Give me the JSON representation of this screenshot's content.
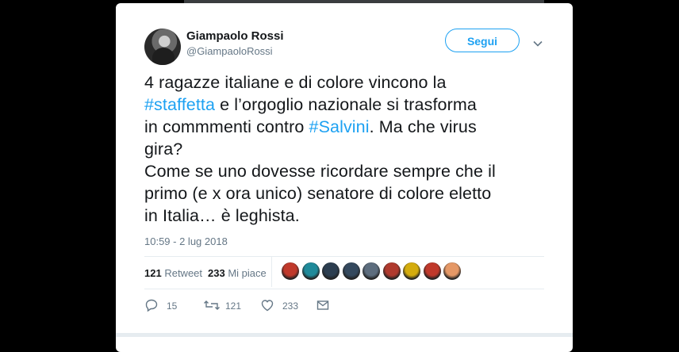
{
  "author": {
    "name": "Giampaolo Rossi",
    "handle": "@GiampaoloRossi"
  },
  "follow_button": {
    "label": "Segui"
  },
  "tweet": {
    "lines": [
      [
        {
          "t": "4 ragazze italiane e di colore vincono la",
          "h": false
        }
      ],
      [
        {
          "t": "#staffetta",
          "h": true
        },
        {
          "t": " e l’orgoglio nazionale si trasforma",
          "h": false
        }
      ],
      [
        {
          "t": "in commmenti contro ",
          "h": false
        },
        {
          "t": "#Salvini",
          "h": true
        },
        {
          "t": ". Ma che virus",
          "h": false
        }
      ],
      [
        {
          "t": "gira?",
          "h": false
        }
      ],
      [
        {
          "t": "Come se uno dovesse ricordare sempre che il",
          "h": false
        }
      ],
      [
        {
          "t": "primo (e x ora unico) senatore di colore eletto",
          "h": false
        }
      ],
      [
        {
          "t": "in Italia… è leghista.",
          "h": false
        }
      ]
    ],
    "timestamp": "10:59 - 2 lug 2018"
  },
  "stats": {
    "retweets_count": "121",
    "retweets_label": "Retweet",
    "likes_count": "233",
    "likes_label": "Mi piace"
  },
  "likers": [
    "#c0392b",
    "#1f8a9a",
    "#2c3e50",
    "#34495e",
    "#5d6d7e",
    "#b03a2e",
    "#d4ac0d",
    "#c0392b",
    "#e59866"
  ],
  "actions": {
    "reply_count": "15",
    "retweet_count": "121",
    "like_count": "233"
  },
  "colors": {
    "accent": "#1da1f2",
    "text": "#14171a",
    "muted": "#657786"
  }
}
